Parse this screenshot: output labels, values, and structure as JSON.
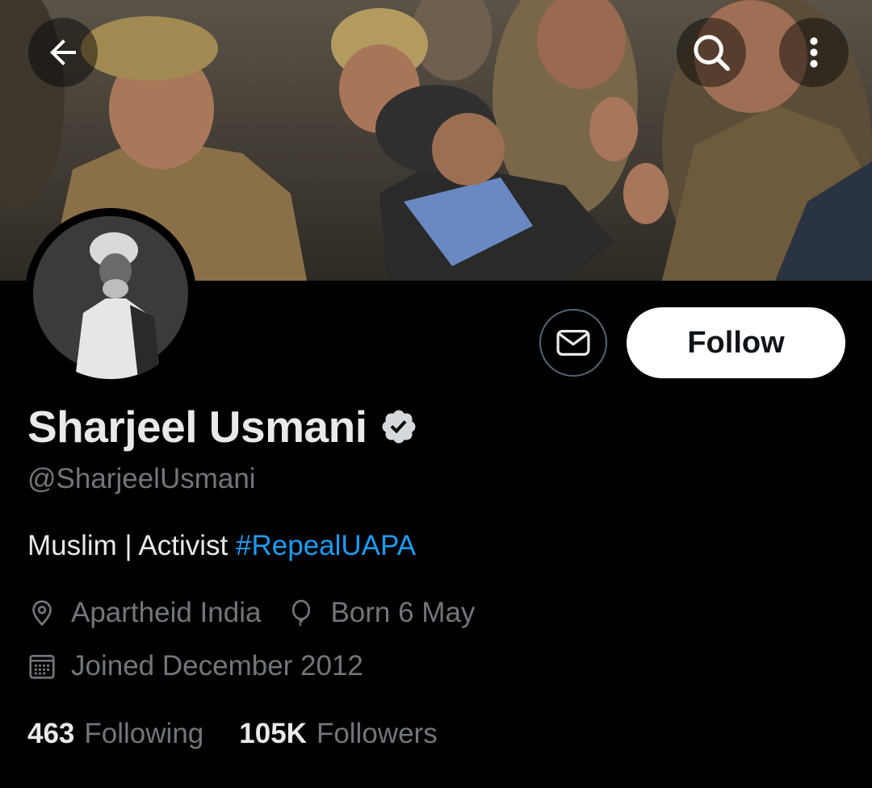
{
  "header": {
    "back_icon": "arrow-left-icon",
    "search_icon": "search-icon",
    "more_icon": "more-vertical-icon"
  },
  "profile": {
    "display_name": "Sharjeel Usmani",
    "handle": "@SharjeelUsmani",
    "bio_text": "Muslim | Activist ",
    "bio_hashtag": "#RepealUAPA",
    "location": "Apartheid India",
    "birthday": "Born 6 May",
    "joined": "Joined December 2012"
  },
  "actions": {
    "follow_label": "Follow",
    "message_icon": "envelope-icon"
  },
  "stats": {
    "following_count": "463",
    "following_label": "Following",
    "followers_count": "105K",
    "followers_label": "Followers"
  },
  "colors": {
    "background": "#000000",
    "primary_text": "#e7e9ea",
    "secondary_text": "#71767b",
    "link": "#1d9bf0",
    "follow_bg": "#ffffff"
  }
}
